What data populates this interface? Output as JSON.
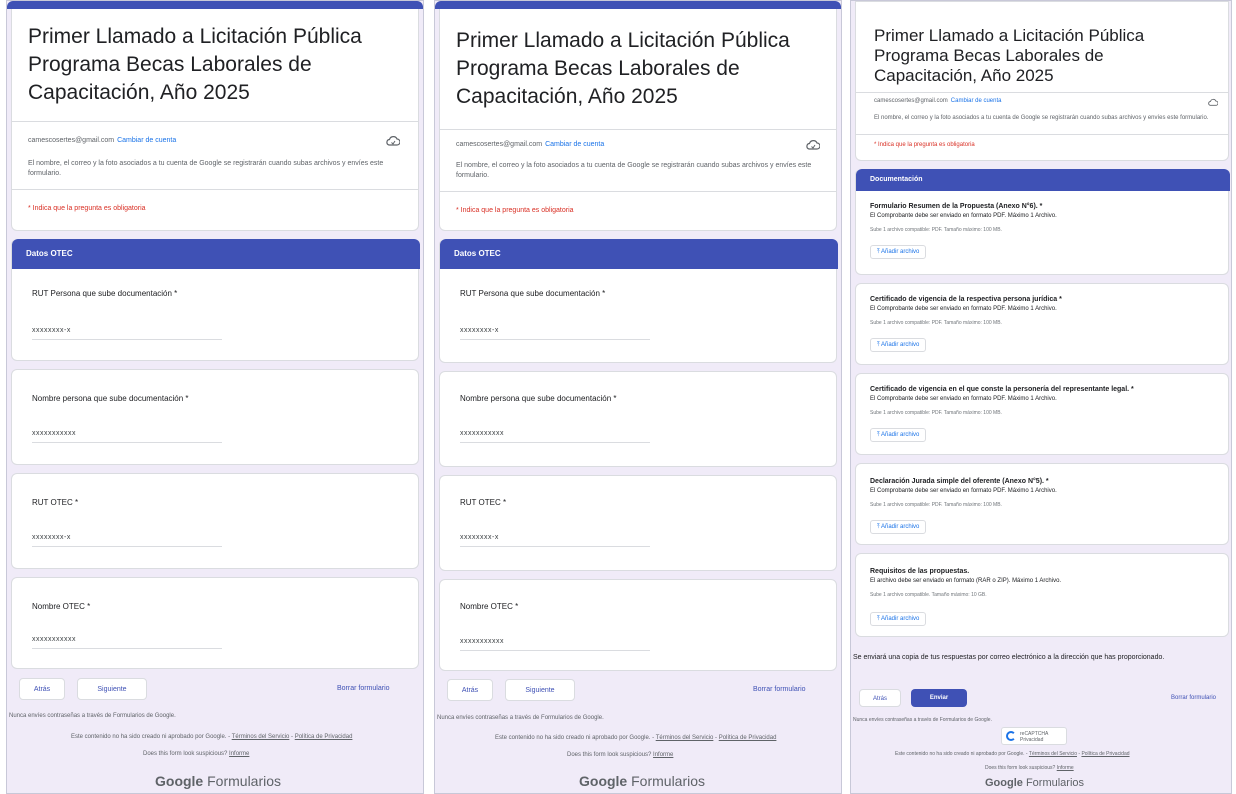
{
  "form": {
    "title_line1": "Primer Llamado a Licitación Pública",
    "title_line2": "Programa Becas Laborales de",
    "title_line3": "Capacitación, Año 2025",
    "account_email": "camescosertes@gmail.com",
    "switch_account": "Cambiar de cuenta",
    "record_notice": "El nombre, el correo y la foto asociados a tu cuenta de Google se registrarán cuando subas archivos y envíes este formulario.",
    "required_notice": "* Indica que la pregunta es obligatoria"
  },
  "page1": {
    "section_title": "Datos OTEC",
    "questions": [
      {
        "label": "RUT Persona que sube documentación *",
        "value": "xxxxxxxx-x"
      },
      {
        "label": "Nombre persona que sube documentación *",
        "value": "xxxxxxxxxxx"
      },
      {
        "label": "RUT OTEC *",
        "value": "xxxxxxxx-x"
      },
      {
        "label": "Nombre OTEC *",
        "value": "xxxxxxxxxxx"
      }
    ],
    "back_label": "Atrás",
    "next_label": "Siguiente",
    "clear_label": "Borrar formulario"
  },
  "page3": {
    "section_title": "Documentación",
    "docs": [
      {
        "label": "Formulario Resumen de la Propuesta (Anexo N°6). *",
        "sub": "El Comprobante debe ser enviado en formato PDF. Máximo 1 Archivo.",
        "note": "Sube 1 archivo compatible: PDF. Tamaño máximo: 100 MB."
      },
      {
        "label": "Certificado de vigencia de la respectiva persona jurídica *",
        "sub": "El Comprobante debe ser enviado en formato PDF. Máximo 1 Archivo.",
        "note": "Sube 1 archivo compatible: PDF. Tamaño máximo: 100 MB."
      },
      {
        "label": "Certificado de vigencia en el que conste la personería del representante legal. *",
        "sub": "El Comprobante debe ser enviado en formato PDF. Máximo 1 Archivo.",
        "note": "Sube 1 archivo compatible: PDF. Tamaño máximo: 100 MB."
      },
      {
        "label": "Declaración Jurada simple del oferente (Anexo N°5). *",
        "sub": "El Comprobante debe ser enviado en formato PDF. Máximo 1 Archivo.",
        "note": "Sube 1 archivo compatible: PDF. Tamaño máximo: 100 MB."
      },
      {
        "label": "Requisitos de las propuestas.",
        "sub": "El archivo debe ser enviado en formato (RAR o ZIP). Máximo 1 Archivo.",
        "note": "Sube 1 archivo compatible. Tamaño máximo: 10 GB."
      }
    ],
    "upload_label": "Añadir archivo",
    "copy_notice": "Se enviará una copia de tus respuestas por correo electrónico a la dirección que has proporcionado.",
    "back_label": "Atrás",
    "submit_label": "Enviar",
    "clear_label": "Borrar formulario",
    "badge_text": "reCAPTCHA Privacidad"
  },
  "footer": {
    "never_passwords": "Nunca envíes contraseñas a través de Formularios de Google.",
    "disclaimer": "Este contenido no ha sido creado ni aprobado por Google.",
    "terms": "Términos del Servicio",
    "privacy": "Política de Privacidad",
    "suspicious": "Does this form look suspicious?",
    "report": "Informe",
    "brand_google": "Google",
    "brand_product": "Formularios"
  },
  "colors": {
    "accent": "#3f51b5",
    "background": "#f0ebf8",
    "required": "#d93025",
    "link": "#1a73e8"
  },
  "icons": [
    "cloud-icon",
    "upload-icon",
    "recaptcha-icon"
  ]
}
